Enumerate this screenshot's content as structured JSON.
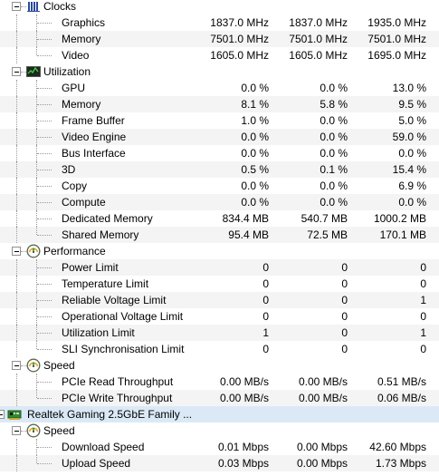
{
  "tree": [
    {
      "kind": "group",
      "label": "Clocks",
      "icon": "clock-bars-icon",
      "slug": "clocks"
    },
    {
      "kind": "item",
      "label": "Graphics",
      "values": [
        "1837.0 MHz",
        "1837.0 MHz",
        "1935.0 MHz"
      ]
    },
    {
      "kind": "item",
      "label": "Memory",
      "values": [
        "7501.0 MHz",
        "7501.0 MHz",
        "7501.0 MHz"
      ]
    },
    {
      "kind": "item",
      "label": "Video",
      "values": [
        "1605.0 MHz",
        "1605.0 MHz",
        "1695.0 MHz"
      ]
    },
    {
      "kind": "group",
      "label": "Utilization",
      "icon": "utilization-graph-icon",
      "slug": "utilization"
    },
    {
      "kind": "item",
      "label": "GPU",
      "values": [
        "0.0 %",
        "0.0 %",
        "13.0 %"
      ]
    },
    {
      "kind": "item",
      "label": "Memory",
      "values": [
        "8.1 %",
        "5.8 %",
        "9.5 %"
      ]
    },
    {
      "kind": "item",
      "label": "Frame Buffer",
      "values": [
        "1.0 %",
        "0.0 %",
        "5.0 %"
      ]
    },
    {
      "kind": "item",
      "label": "Video Engine",
      "values": [
        "0.0 %",
        "0.0 %",
        "59.0 %"
      ]
    },
    {
      "kind": "item",
      "label": "Bus Interface",
      "values": [
        "0.0 %",
        "0.0 %",
        "0.0 %"
      ]
    },
    {
      "kind": "item",
      "label": "3D",
      "values": [
        "0.5 %",
        "0.1 %",
        "15.4 %"
      ]
    },
    {
      "kind": "item",
      "label": "Copy",
      "values": [
        "0.0 %",
        "0.0 %",
        "6.9 %"
      ]
    },
    {
      "kind": "item",
      "label": "Compute",
      "values": [
        "0.0 %",
        "0.0 %",
        "0.0 %"
      ]
    },
    {
      "kind": "item",
      "label": "Dedicated Memory",
      "values": [
        "834.4 MB",
        "540.7 MB",
        "1000.2 MB"
      ]
    },
    {
      "kind": "item",
      "label": "Shared Memory",
      "values": [
        "95.4 MB",
        "72.5 MB",
        "170.1 MB"
      ]
    },
    {
      "kind": "group",
      "label": "Performance",
      "icon": "gauge-icon",
      "slug": "performance"
    },
    {
      "kind": "item",
      "label": "Power Limit",
      "values": [
        "0",
        "0",
        "0"
      ]
    },
    {
      "kind": "item",
      "label": "Temperature Limit",
      "values": [
        "0",
        "0",
        "0"
      ]
    },
    {
      "kind": "item",
      "label": "Reliable Voltage Limit",
      "values": [
        "0",
        "0",
        "1"
      ]
    },
    {
      "kind": "item",
      "label": "Operational Voltage Limit",
      "values": [
        "0",
        "0",
        "0"
      ]
    },
    {
      "kind": "item",
      "label": "Utilization Limit",
      "values": [
        "1",
        "0",
        "1"
      ]
    },
    {
      "kind": "item",
      "label": "SLI Synchronisation Limit",
      "values": [
        "0",
        "0",
        "0"
      ]
    },
    {
      "kind": "group",
      "label": "Speed",
      "icon": "gauge-icon",
      "slug": "speed"
    },
    {
      "kind": "item",
      "label": "PCIe Read Throughput",
      "values": [
        "0.00 MB/s",
        "0.00 MB/s",
        "0.51 MB/s"
      ]
    },
    {
      "kind": "item",
      "label": "PCIe Write Throughput",
      "values": [
        "0.00 MB/s",
        "0.00 MB/s",
        "0.06 MB/s"
      ]
    },
    {
      "kind": "device",
      "label": "Realtek Gaming 2.5GbE Family ...",
      "icon": "network-adapter-icon",
      "slug": "realtek-adapter"
    },
    {
      "kind": "group",
      "label": "Speed",
      "icon": "gauge-icon",
      "slug": "network-speed"
    },
    {
      "kind": "item",
      "label": "Download Speed",
      "values": [
        "0.01 Mbps",
        "0.00 Mbps",
        "42.60 Mbps"
      ]
    },
    {
      "kind": "item",
      "label": "Upload Speed",
      "values": [
        "0.03 Mbps",
        "0.00 Mbps",
        "1.73 Mbps"
      ]
    }
  ]
}
